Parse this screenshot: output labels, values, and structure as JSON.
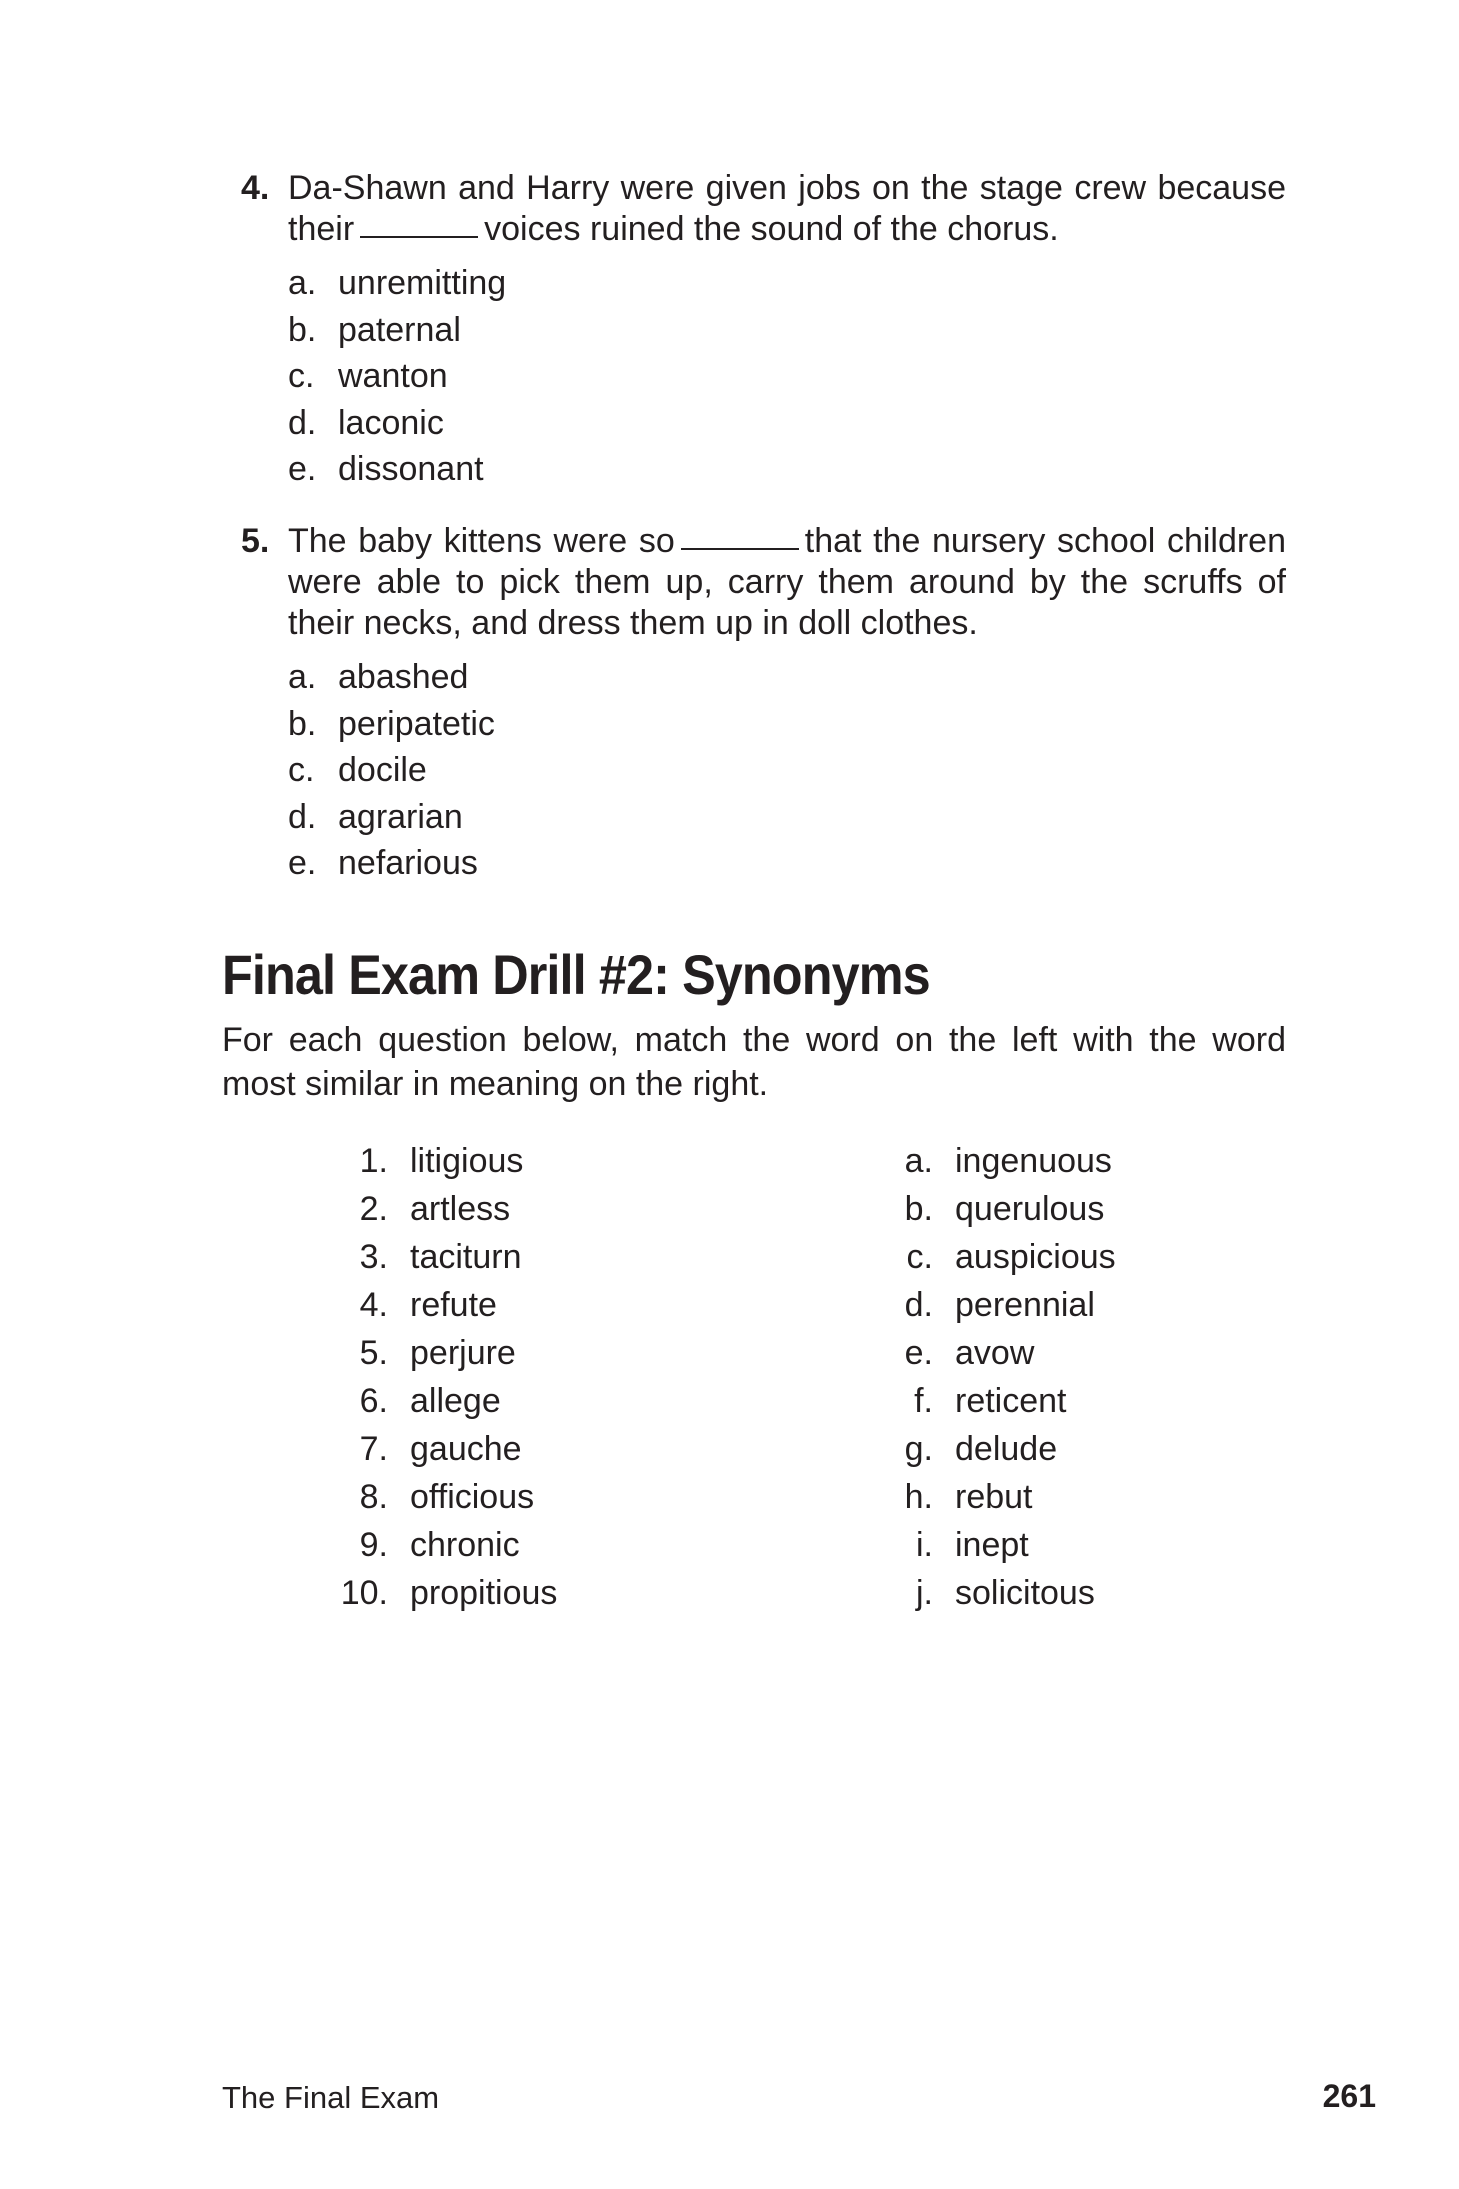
{
  "questions": [
    {
      "number": "4.",
      "stem_before": "Da-Shawn and Harry were given jobs on the stage crew because their",
      "stem_after": "voices ruined the sound of the chorus.",
      "choices": [
        {
          "letter": "a.",
          "text": "unremitting"
        },
        {
          "letter": "b.",
          "text": "paternal"
        },
        {
          "letter": "c.",
          "text": "wanton"
        },
        {
          "letter": "d.",
          "text": "laconic"
        },
        {
          "letter": "e.",
          "text": "dissonant"
        }
      ]
    },
    {
      "number": "5.",
      "stem_before": "The baby kittens were so",
      "stem_after": "that the nursery school children were able to pick them up, carry them around by the scruffs of their necks, and dress them up in doll clothes.",
      "choices": [
        {
          "letter": "a.",
          "text": "abashed"
        },
        {
          "letter": "b.",
          "text": "peripatetic"
        },
        {
          "letter": "c.",
          "text": "docile"
        },
        {
          "letter": "d.",
          "text": "agrarian"
        },
        {
          "letter": "e.",
          "text": "nefarious"
        }
      ]
    }
  ],
  "section": {
    "title": "Final Exam Drill #2: Synonyms",
    "instructions": "For each question below, match the word on the left with the word most similar in meaning on the right."
  },
  "matching": {
    "left": [
      {
        "key": "1.",
        "word": "litigious"
      },
      {
        "key": "2.",
        "word": "artless"
      },
      {
        "key": "3.",
        "word": "taciturn"
      },
      {
        "key": "4.",
        "word": "refute"
      },
      {
        "key": "5.",
        "word": "perjure"
      },
      {
        "key": "6.",
        "word": "allege"
      },
      {
        "key": "7.",
        "word": "gauche"
      },
      {
        "key": "8.",
        "word": "officious"
      },
      {
        "key": "9.",
        "word": "chronic"
      },
      {
        "key": "10.",
        "word": "propitious"
      }
    ],
    "right": [
      {
        "key": "a.",
        "word": "ingenuous"
      },
      {
        "key": "b.",
        "word": "querulous"
      },
      {
        "key": "c.",
        "word": "auspicious"
      },
      {
        "key": "d.",
        "word": "perennial"
      },
      {
        "key": "e.",
        "word": "avow"
      },
      {
        "key": "f.",
        "word": "reticent"
      },
      {
        "key": "g.",
        "word": "delude"
      },
      {
        "key": "h.",
        "word": "rebut"
      },
      {
        "key": "i.",
        "word": "inept"
      },
      {
        "key": "j.",
        "word": "solicitous"
      }
    ]
  },
  "footer": {
    "title": "The Final Exam",
    "page_number": "261"
  }
}
